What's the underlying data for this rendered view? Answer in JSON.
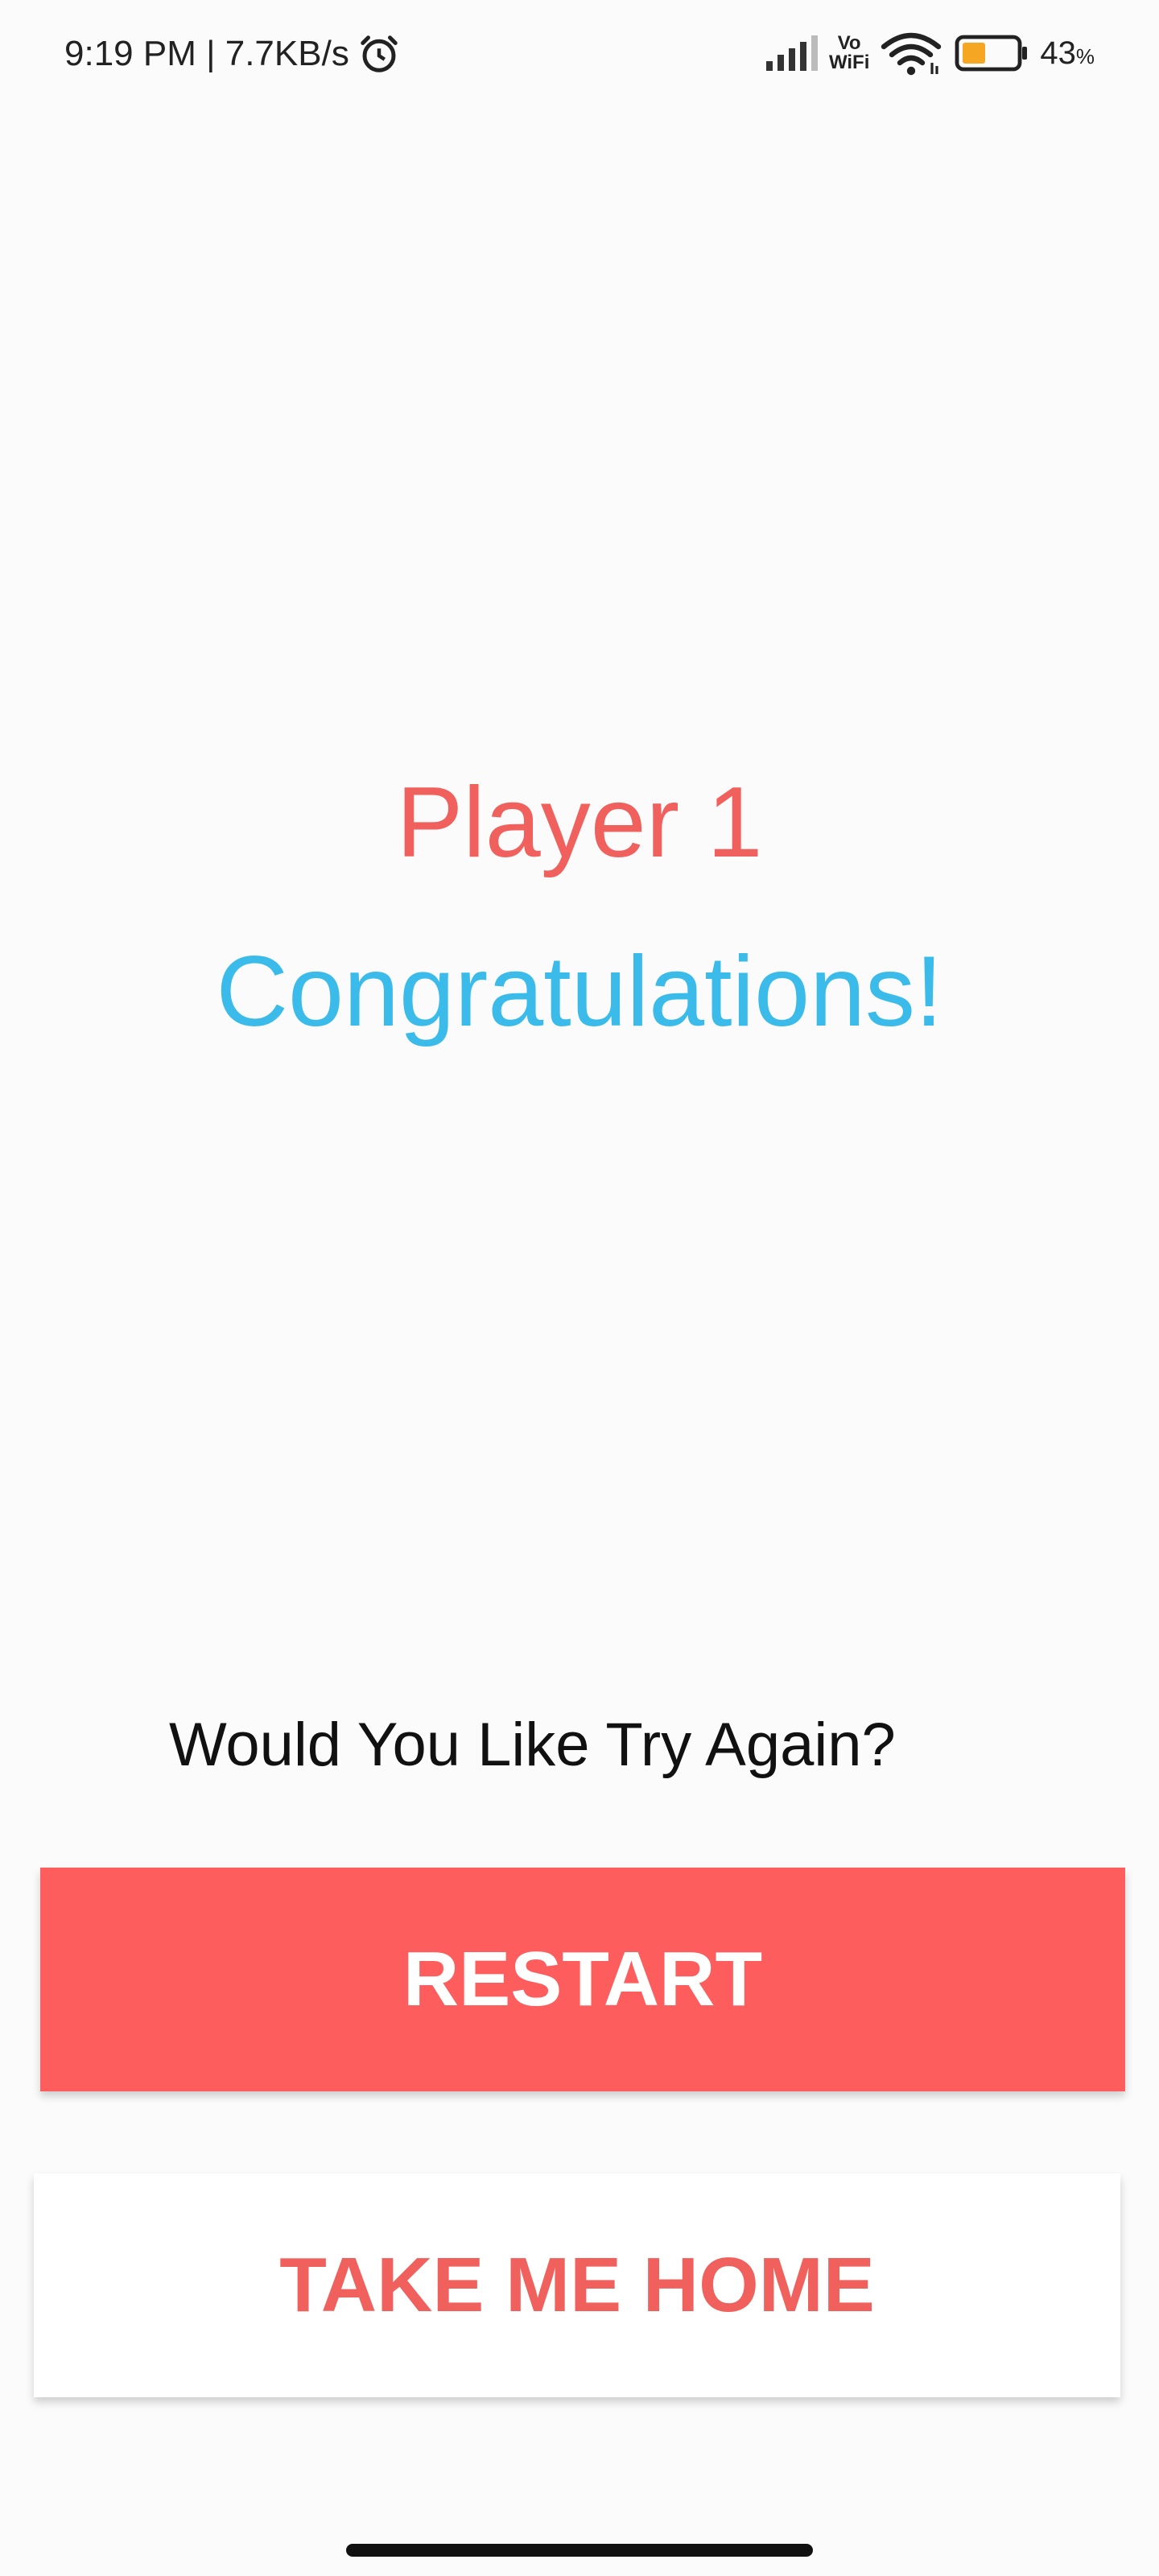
{
  "status_bar": {
    "time": "9:19 PM | 7.7KB/s",
    "alarm_icon": "alarm-clock-icon",
    "signal_icon": "cell-signal-icon",
    "vowifi_top": "Vo",
    "vowifi_bottom": "WiFi",
    "wifi_icon": "wifi-icon",
    "battery_icon": "battery-icon",
    "battery_percent": "43",
    "battery_unit": "%"
  },
  "result": {
    "player": "Player 1",
    "message": "Congratulations!"
  },
  "prompt": "Would You Like Try Again?",
  "buttons": {
    "restart": "RESTART",
    "home": "TAKE ME HOME"
  },
  "colors": {
    "accent_red": "#f0605d",
    "restart_bg": "#fe5d5d",
    "congrats_blue": "#3bbbe9",
    "battery_fill": "#f5a623"
  }
}
